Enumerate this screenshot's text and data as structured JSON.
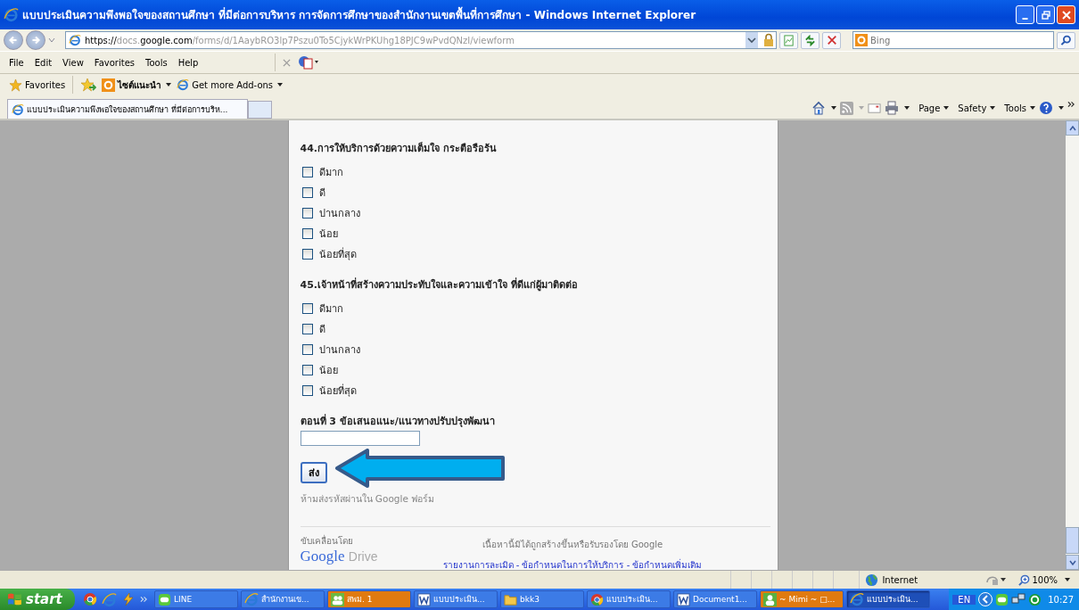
{
  "window": {
    "title": "แบบประเมินความพึงพอใจของสถานศึกษา ที่มีต่อการบริหาร การจัดการศึกษาของสำนักงานเขตพื้นที่การศึกษา - Windows Internet Explorer"
  },
  "address_bar": {
    "scheme": "https://",
    "host_pre": "docs.",
    "host": "google.com",
    "path": "/forms/d/1AaybRO3lp7Pszu0To5CjykWrPKUhg18PJC9wPvdQNzI/viewform"
  },
  "search": {
    "placeholder": "Bing"
  },
  "menu": [
    "File",
    "Edit",
    "View",
    "Favorites",
    "Tools",
    "Help"
  ],
  "favorites_bar": {
    "favorites": "Favorites",
    "items": [
      "ไซต์แนะนำ",
      "Get more Add-ons"
    ]
  },
  "tabs": [
    {
      "label": "แบบประเมินความพึงพอใจของสถานศึกษา ที่มีต่อการบริห...",
      "selected": true
    }
  ],
  "command_bar": [
    "Page",
    "Safety",
    "Tools"
  ],
  "questions": [
    {
      "title": "44.การให้บริการด้วยความเต็มใจ กระตือรือร้น",
      "options": [
        {
          "label": "ดีมาก",
          "checked": false
        },
        {
          "label": "ดี",
          "checked": false
        },
        {
          "label": "ปานกลาง",
          "checked": false
        },
        {
          "label": "น้อย",
          "checked": false
        },
        {
          "label": "น้อยที่สุด",
          "checked": false
        }
      ]
    },
    {
      "title": "45.เจ้าหน้าที่สร้างความประทับใจและความเข้าใจ ที่ดีแก่ผู้มาติดต่อ",
      "options": [
        {
          "label": "ดีมาก",
          "checked": false
        },
        {
          "label": "ดี",
          "checked": false
        },
        {
          "label": "ปานกลาง",
          "checked": false
        },
        {
          "label": "น้อย",
          "checked": false
        },
        {
          "label": "น้อยที่สุด",
          "checked": false
        }
      ]
    }
  ],
  "suggestion": {
    "title": "ตอนที่ 3 ข้อเสนอแนะ/แนวทางปรับปรุงพัฒนา"
  },
  "submit": "ส่ง",
  "password_note": "ห้ามส่งรหัสผ่านใน Google ฟอร์ม",
  "footer": {
    "powered_by": "ขับเคลื่อนโดย",
    "logo": "Google",
    "logo_product": "Drive",
    "disclaimer": "เนื้อหานี้มิได้ถูกสร้างขึ้นหรือรับรองโดย Google",
    "links": [
      "รายงานการละเมิด",
      "ข้อกำหนดในการให้บริการ",
      "ข้อกำหนดเพิ่มเติม"
    ],
    "separator": " - "
  },
  "status_bar": {
    "zone": "Internet",
    "zoom": "100%"
  },
  "taskbar": {
    "start": "start",
    "items": [
      {
        "label": "LINE",
        "kind": "line",
        "selected": false,
        "color": "#3c7be6"
      },
      {
        "label": "สำนักงานเข...",
        "kind": "ie",
        "selected": false,
        "color": "#3c7be6"
      },
      {
        "label": "สพม. 1",
        "kind": "people",
        "selected": false,
        "color": "#e07a10"
      },
      {
        "label": "แบบประเมิน...",
        "kind": "word",
        "selected": false,
        "color": "#3c7be6"
      },
      {
        "label": "bkk3",
        "kind": "folder",
        "selected": false,
        "color": "#3c7be6"
      },
      {
        "label": "แบบประเมิน...",
        "kind": "chrome",
        "selected": false,
        "color": "#3c7be6"
      },
      {
        "label": "Document1...",
        "kind": "word",
        "selected": false,
        "color": "#3c7be6"
      },
      {
        "label": "~ Mimi ~ □...",
        "kind": "person",
        "selected": false,
        "color": "#e07a10"
      },
      {
        "label": "แบบประเมิน...",
        "kind": "ie",
        "selected": true,
        "color": "#1e4fb8"
      }
    ],
    "language": "EN",
    "clock": "10:27"
  }
}
